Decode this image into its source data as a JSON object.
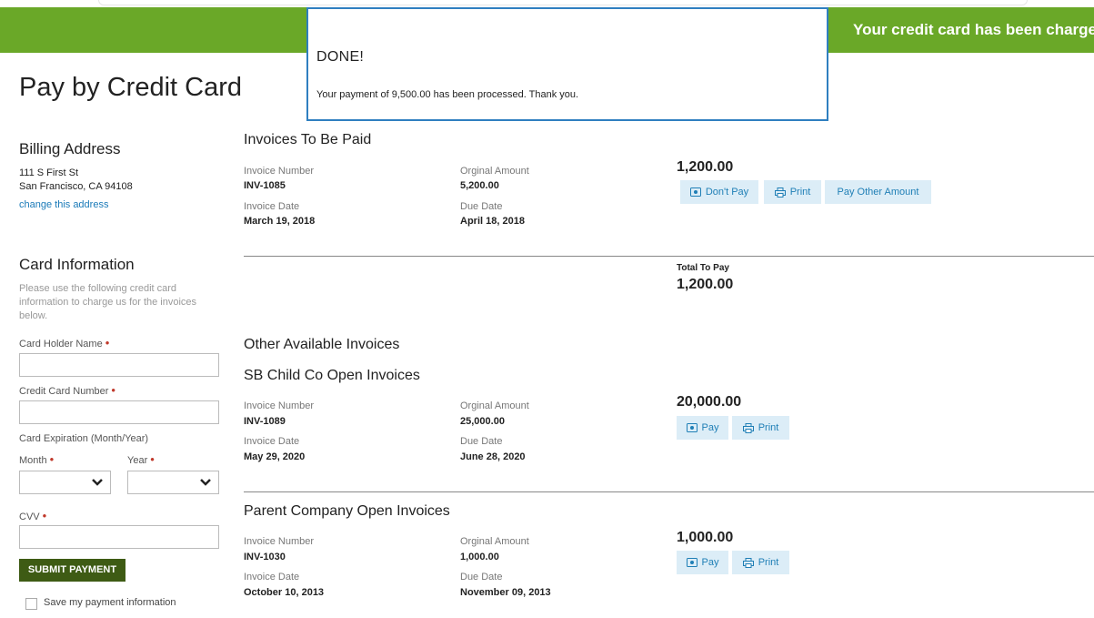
{
  "banner": {
    "text": "Your credit card has been charged"
  },
  "modal": {
    "title": "DONE!",
    "message": "Your payment of 9,500.00 has been processed. Thank you."
  },
  "page": {
    "title": "Pay by Credit Card"
  },
  "billing": {
    "heading": "Billing Address",
    "line1": "111 S First St",
    "line2": "San Francisco, CA  94108",
    "change_link": "change this address"
  },
  "card": {
    "heading": "Card Information",
    "help": "Please use the following credit card information to charge us for the invoices below.",
    "holder_label": "Card Holder Name",
    "number_label": "Credit Card Number",
    "expiration_label": "Card Expiration (Month/Year)",
    "month_label": "Month",
    "year_label": "Year",
    "cvv_label": "CVV",
    "required_mark": "•",
    "submit_label": "SUBMIT PAYMENT",
    "save_label": "Save my payment information"
  },
  "labels": {
    "invoice_number": "Invoice Number",
    "original_amount": "Orginal Amount",
    "invoice_date": "Invoice Date",
    "due_date": "Due Date"
  },
  "to_pay": {
    "heading": "Invoices To Be Paid",
    "invoice": {
      "number": "INV-1085",
      "original": "5,200.00",
      "invoice_date": "March 19, 2018",
      "due_date": "April 18, 2018",
      "amount": "1,200.00"
    },
    "buttons": {
      "dont_pay": "Don't Pay",
      "print": "Print",
      "pay_other": "Pay Other Amount"
    },
    "total_label": "Total To Pay",
    "total_value": "1,200.00"
  },
  "other": {
    "heading": "Other Available Invoices",
    "groups": [
      {
        "heading": "SB Child Co Open Invoices",
        "invoice": {
          "number": "INV-1089",
          "original": "25,000.00",
          "invoice_date": "May 29, 2020",
          "due_date": "June 28, 2020",
          "amount": "20,000.00"
        },
        "pay_label": "Pay",
        "print_label": "Print"
      },
      {
        "heading": "Parent Company Open Invoices",
        "invoice": {
          "number": "INV-1030",
          "original": "1,000.00",
          "invoice_date": "October 10, 2013",
          "due_date": "November 09, 2013",
          "amount": "1,000.00"
        },
        "pay_label": "Pay",
        "print_label": "Print"
      }
    ]
  },
  "colors": {
    "banner": "#6aa828",
    "submit": "#3e5b14",
    "link": "#1a7ab8",
    "button_bg": "#dcedf7",
    "modal_border": "#2f7fc0"
  }
}
